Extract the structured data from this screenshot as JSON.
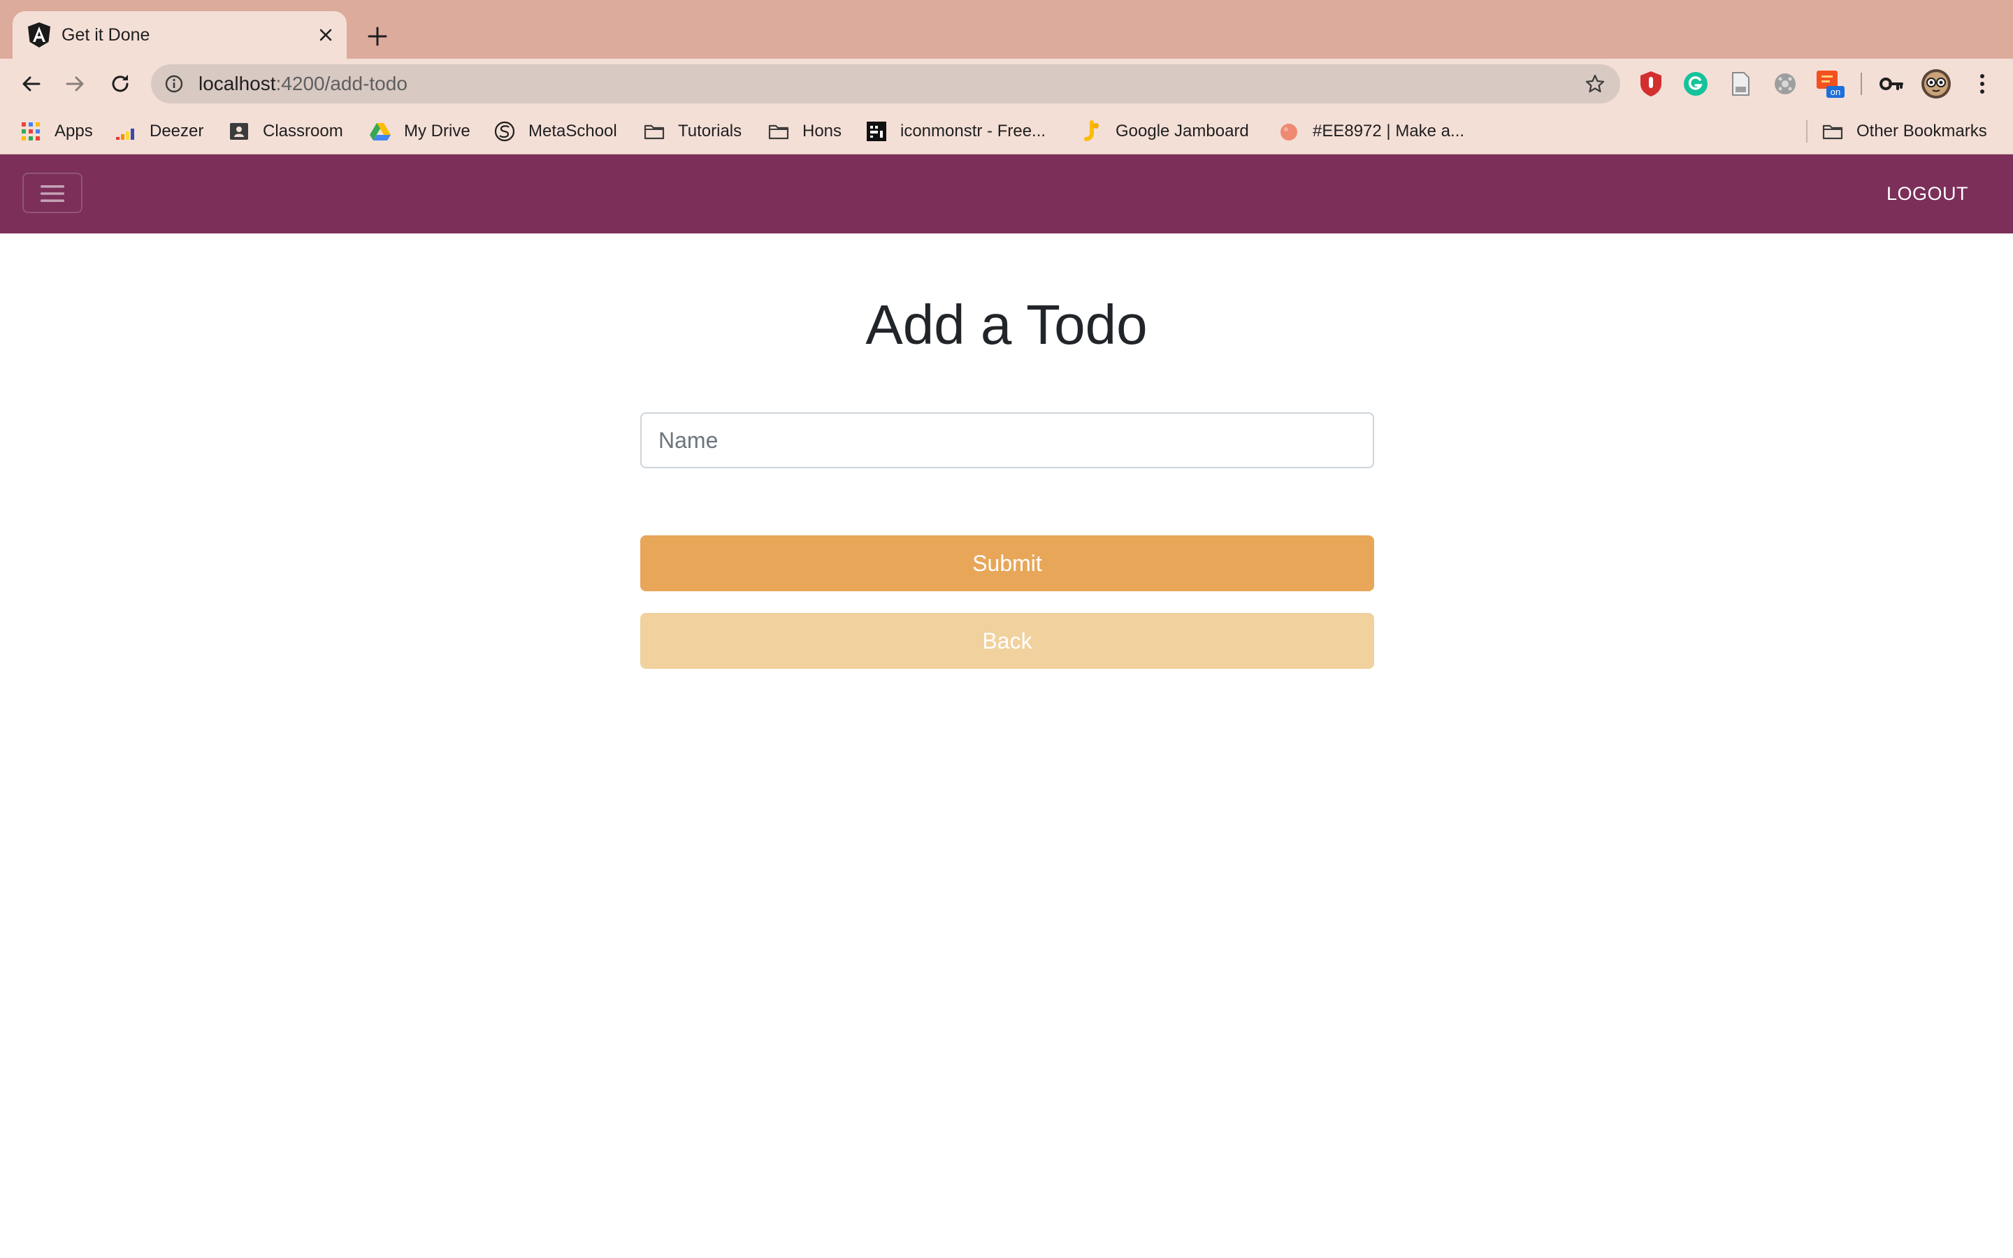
{
  "browser": {
    "tab": {
      "title": "Get it Done",
      "favicon": "angular-logo-icon"
    },
    "address_bar": {
      "host": "localhost",
      "path": ":4200/add-todo"
    },
    "extensions": [
      "ublock-icon",
      "grammarly-icon",
      "document-icon",
      "puzzle-icon",
      "pdf-on-icon",
      "key-icon",
      "profile-avatar-icon",
      "more-menu-icon"
    ],
    "extension_badge": "on",
    "bookmarks": [
      {
        "label": "Apps",
        "icon": "apps-grid-icon"
      },
      {
        "label": "Deezer",
        "icon": "deezer-icon"
      },
      {
        "label": "Classroom",
        "icon": "classroom-icon"
      },
      {
        "label": "My Drive",
        "icon": "google-drive-icon"
      },
      {
        "label": "MetaSchool",
        "icon": "metaschool-icon"
      },
      {
        "label": "Tutorials",
        "icon": "folder-icon"
      },
      {
        "label": "Hons",
        "icon": "folder-icon"
      },
      {
        "label": "iconmonstr - Free...",
        "icon": "iconmonstr-icon"
      },
      {
        "label": "Google Jamboard",
        "icon": "jamboard-icon"
      },
      {
        "label": "#EE8972 | Make a...",
        "icon": "color-swatch-icon"
      }
    ],
    "other_bookmarks": "Other Bookmarks"
  },
  "navbar": {
    "background": "#7b2f59",
    "toggle_icon": "hamburger-menu-icon",
    "logout_label": "LOGOUT"
  },
  "main": {
    "title": "Add a Todo",
    "name_input": {
      "placeholder": "Name",
      "value": ""
    },
    "submit_label": "Submit",
    "back_label": "Back",
    "colors": {
      "submit": "#e8a658",
      "back": "#f1d19e"
    }
  }
}
